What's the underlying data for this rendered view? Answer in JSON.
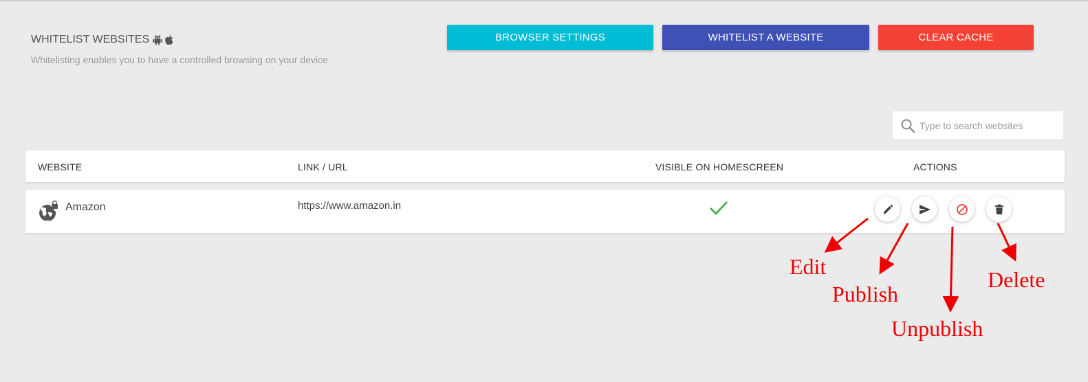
{
  "header": {
    "title": "WHITELIST WEBSITES",
    "platform_icons": [
      "android-icon",
      "apple-icon"
    ],
    "subtitle": "Whitelisting enables you to have a controlled browsing on your device"
  },
  "toolbar": {
    "browser_settings_label": "BROWSER SETTINGS",
    "whitelist_label": "WHITELIST A WEBSITE",
    "clear_cache_label": "CLEAR CACHE"
  },
  "search": {
    "placeholder": "Type to search websites",
    "value": "",
    "icon": "search-icon"
  },
  "table": {
    "columns": [
      "WEBSITE",
      "LINK / URL",
      "VISIBLE ON HOMESCREEN",
      "ACTIONS"
    ],
    "rows": [
      {
        "icon": "web-lock-icon",
        "website": "Amazon",
        "url": "https://www.amazon.in",
        "visible_on_homescreen": true,
        "actions": [
          "edit-icon",
          "send-icon",
          "block-icon",
          "delete-icon"
        ]
      }
    ]
  },
  "annotations": {
    "edit": "Edit",
    "publish": "Publish",
    "unpublish": "Unpublish",
    "delete": "Delete"
  },
  "colors": {
    "background": "#ebebeb",
    "browser_settings": "#00bcd4",
    "whitelist": "#3f51b5",
    "clear_cache": "#f44336",
    "check": "#4caf50",
    "annotation": "#e00000"
  }
}
